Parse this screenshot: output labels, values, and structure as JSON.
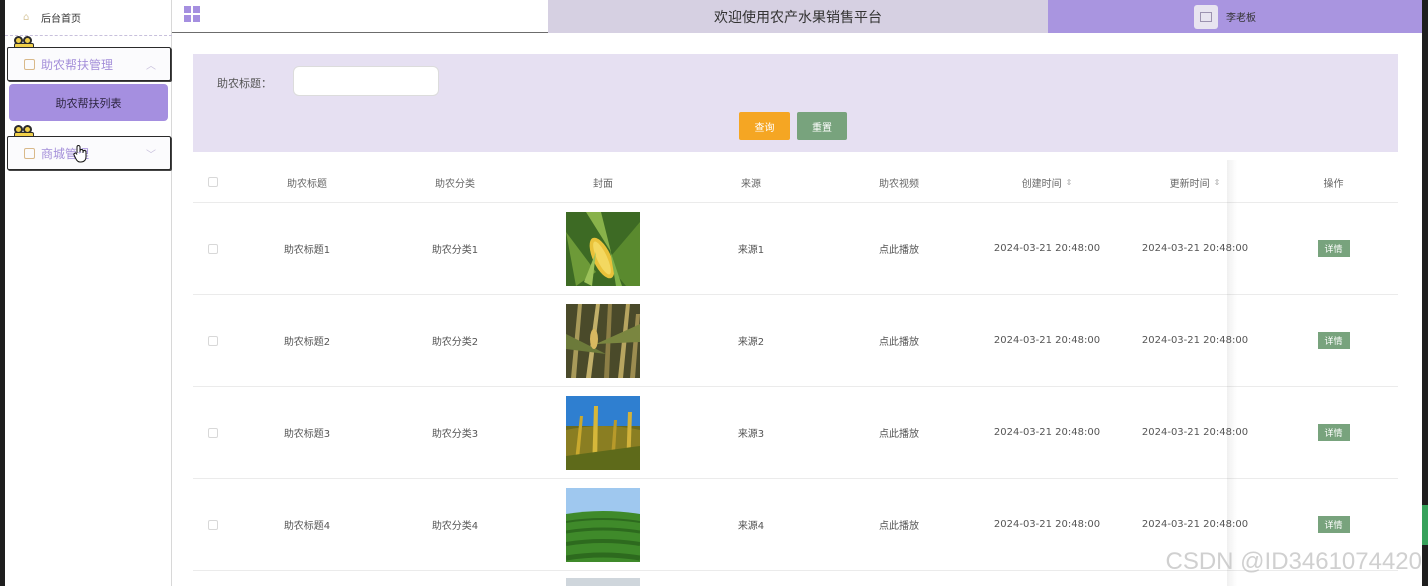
{
  "sidebar": {
    "home": "后台首页",
    "group1": "助农帮扶管理",
    "group1_item": "助农帮扶列表",
    "group2": "商城管理"
  },
  "header": {
    "title": "欢迎使用农产水果销售平台",
    "user": "李老板"
  },
  "search": {
    "label": "助农标题：",
    "value": "",
    "query_button": "查询",
    "reset_button": "重置"
  },
  "table": {
    "columns": [
      "助农标题",
      "助农分类",
      "封面",
      "来源",
      "助农视频",
      "创建时间",
      "更新时间",
      "操作"
    ],
    "rows": [
      {
        "title": "助农标题1",
        "category": "助农分类1",
        "cover": "corn",
        "source": "来源1",
        "video": "点此播放",
        "created": "2024-03-21 20:48:00",
        "updated": "2024-03-21 20:48:00",
        "action": "详情"
      },
      {
        "title": "助农标题2",
        "category": "助农分类2",
        "cover": "dry-corn",
        "source": "来源2",
        "video": "点此播放",
        "created": "2024-03-21 20:48:00",
        "updated": "2024-03-21 20:48:00",
        "action": "详情"
      },
      {
        "title": "助农标题3",
        "category": "助农分类3",
        "cover": "millet-sky",
        "source": "来源3",
        "video": "点此播放",
        "created": "2024-03-21 20:48:00",
        "updated": "2024-03-21 20:48:00",
        "action": "详情"
      },
      {
        "title": "助农标题4",
        "category": "助农分类4",
        "cover": "green-field",
        "source": "来源4",
        "video": "点此播放",
        "created": "2024-03-21 20:48:00",
        "updated": "2024-03-21 20:48:00",
        "action": "详情"
      }
    ]
  },
  "watermark": "CSDN @ID3461074420",
  "colors": {
    "accent": "#a58fe0",
    "title_bg": "#d6d0e2",
    "panel_bg": "#e6e0f2",
    "query": "#f5a623",
    "reset": "#78a37d"
  }
}
